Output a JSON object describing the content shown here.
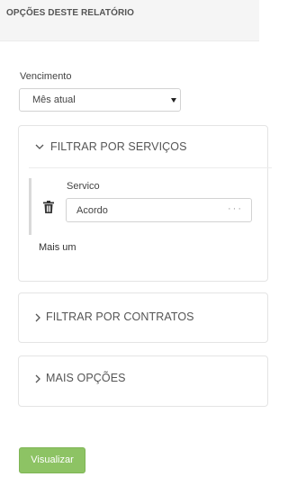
{
  "header": {
    "title": "OPÇÕES DESTE RELATÓRIO"
  },
  "vencimento": {
    "label": "Vencimento",
    "selected": "Mês atual"
  },
  "panels": {
    "servicos": {
      "title": "FILTRAR POR SERVIÇOS",
      "expanded": true,
      "field_label": "Servico",
      "field_value": "Acordo",
      "field_more": "···",
      "add_label": "Mais um"
    },
    "contratos": {
      "title": "FILTRAR POR CONTRATOS",
      "expanded": false
    },
    "mais": {
      "title": "MAIS OPÇÕES",
      "expanded": false
    }
  },
  "actions": {
    "visualizar": "Visualizar"
  },
  "icons": {
    "expanded": "chevron-down-icon",
    "collapsed": "chevron-right-icon",
    "delete": "trash-icon",
    "select": "caret-down-icon"
  },
  "colors": {
    "primary_button": "#8dc364",
    "header_bg": "#f5f5f5"
  }
}
